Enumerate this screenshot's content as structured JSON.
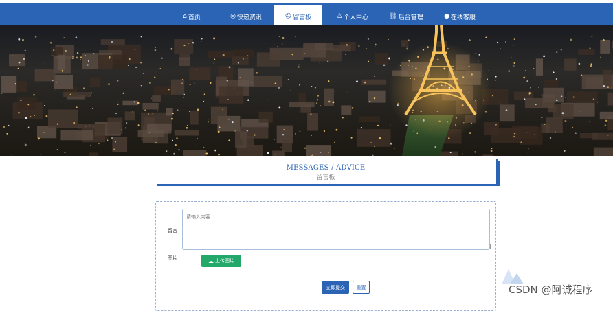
{
  "nav": {
    "items": [
      {
        "label": "首页",
        "icon": "home-icon",
        "glyph": "⌂"
      },
      {
        "label": "快递资讯",
        "icon": "news-icon",
        "glyph": "◎"
      },
      {
        "label": "留言板",
        "icon": "message-icon",
        "glyph": "☺"
      },
      {
        "label": "个人中心",
        "icon": "user-icon",
        "glyph": "♙"
      },
      {
        "label": "后台管理",
        "icon": "link-icon",
        "glyph": "⛓"
      },
      {
        "label": "在线客服",
        "icon": "chat-icon",
        "glyph": "●"
      }
    ],
    "active_index": 2
  },
  "section": {
    "title_en": "MESSAGES / ADVICE",
    "title_cn": "留言板"
  },
  "form": {
    "message_label": "留言",
    "message_placeholder": "请输入内容",
    "image_label": "图片",
    "upload_label": "上传图片",
    "upload_icon": "cloud-upload-icon",
    "submit_label": "立即提交",
    "reset_label": "重置"
  },
  "watermark": "CSDN @阿诚程序",
  "colors": {
    "primary": "#2b64b4",
    "upload_green": "#23a86a"
  }
}
